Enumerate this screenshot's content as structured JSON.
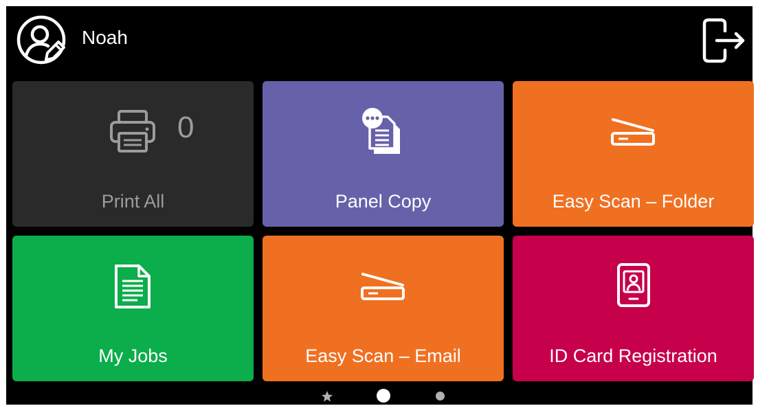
{
  "header": {
    "username": "Noah",
    "avatar_icon": "user-edit-icon",
    "logout_icon": "logout-icon"
  },
  "tiles": [
    {
      "label": "Print All",
      "count": "0",
      "icon": "printer-icon",
      "color": "#2a2a2a"
    },
    {
      "label": "Panel Copy",
      "icon": "copy-document-icon",
      "color": "#6661a9"
    },
    {
      "label": "Easy Scan – Folder",
      "icon": "scanner-icon",
      "color": "#f07021"
    },
    {
      "label": "My Jobs",
      "icon": "document-icon",
      "color": "#0cad4b"
    },
    {
      "label": "Easy Scan – Email",
      "icon": "scanner-icon",
      "color": "#f07021"
    },
    {
      "label": "ID Card Registration",
      "icon": "id-card-icon",
      "color": "#c6004b"
    }
  ],
  "pager": {
    "pages": [
      "favorites",
      "page-1",
      "page-2"
    ],
    "active_page": 1,
    "active_color": "#ffffff",
    "inactive_color": "#b0b0b0"
  }
}
